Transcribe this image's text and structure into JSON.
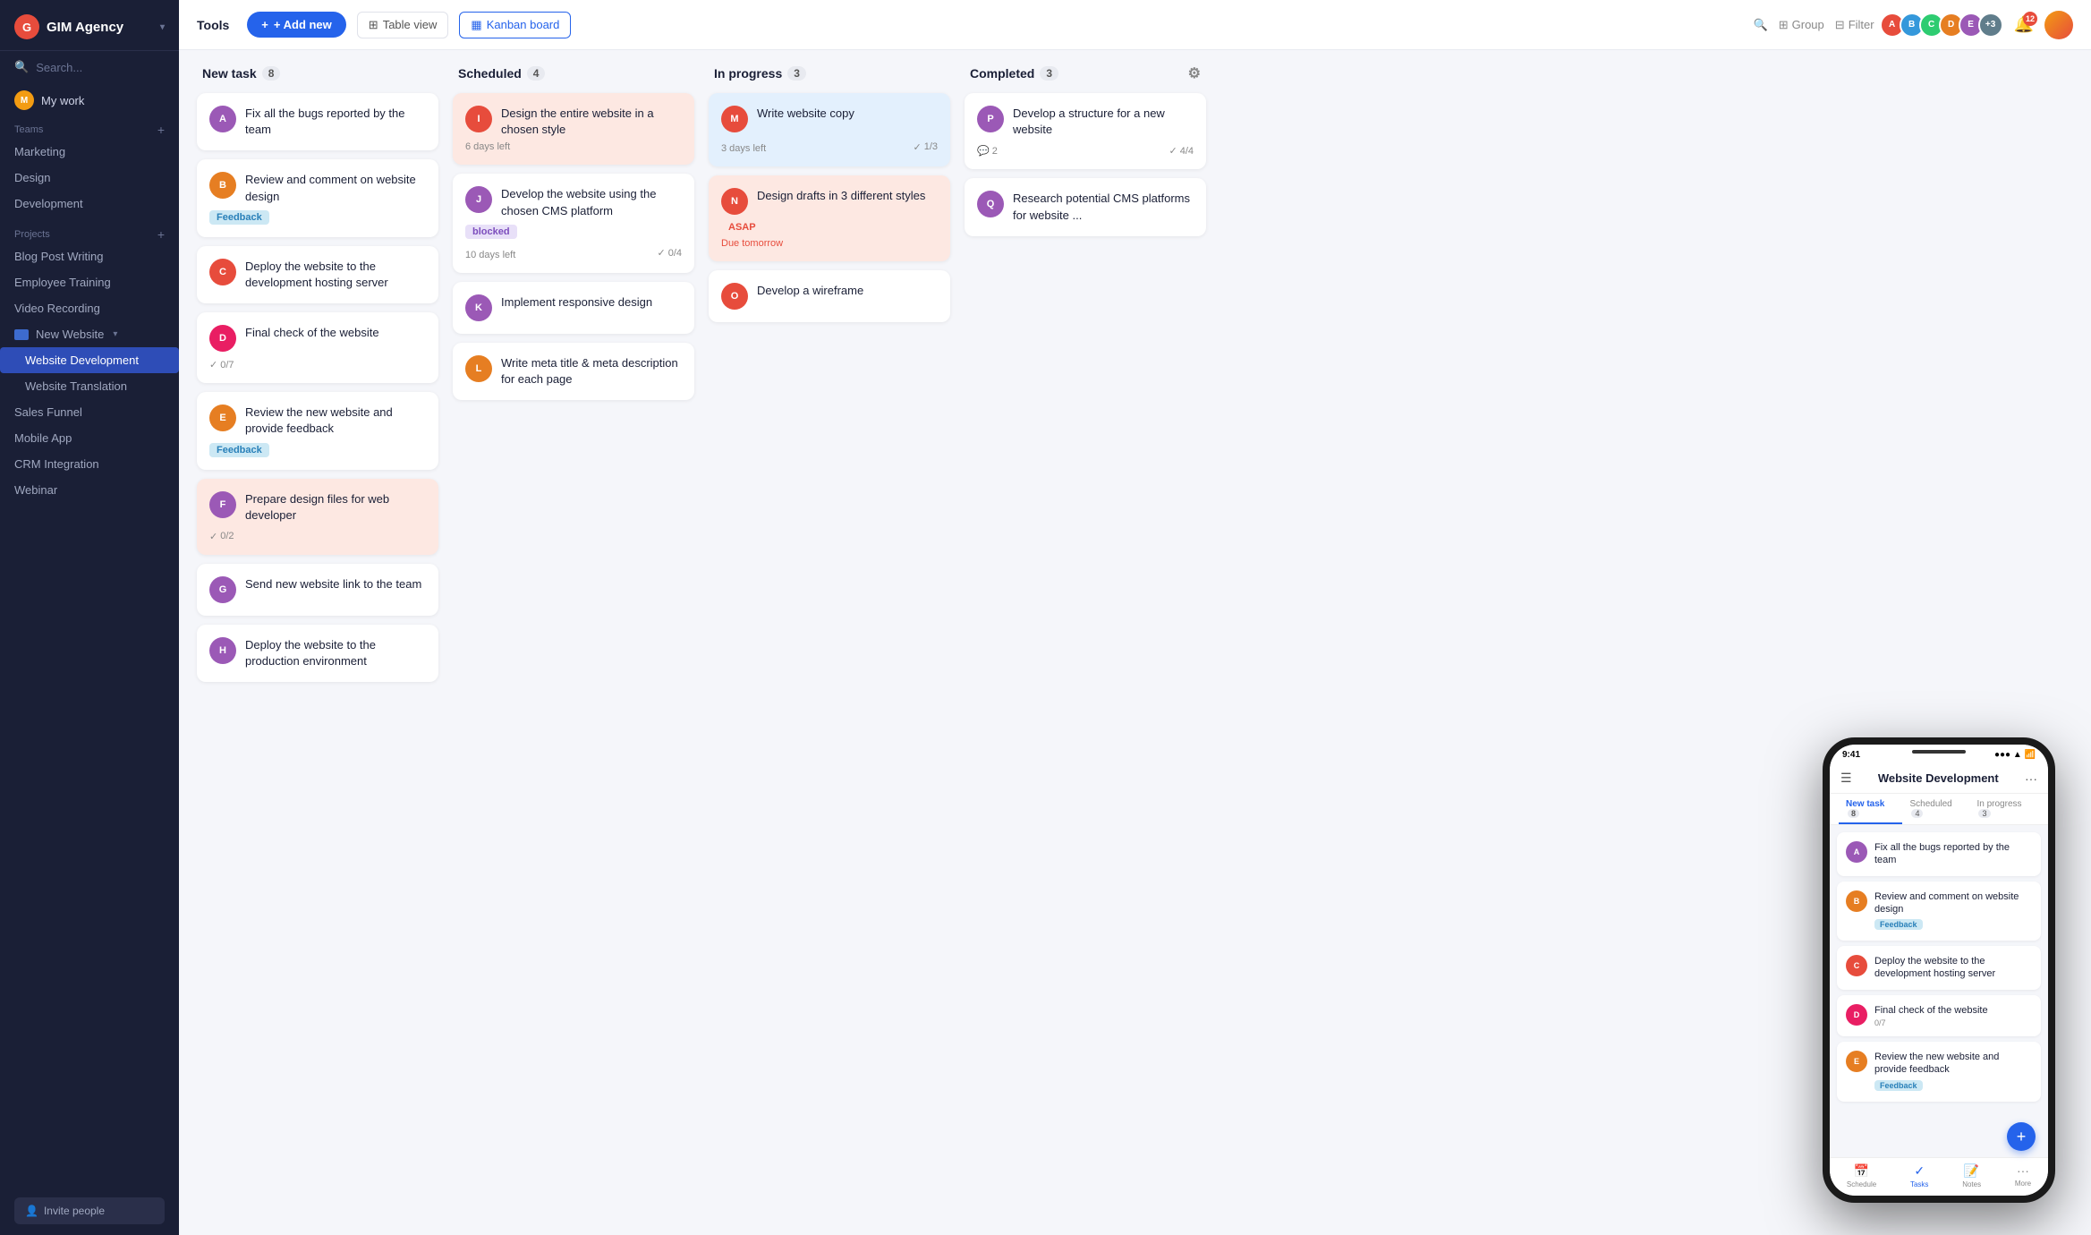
{
  "app": {
    "name": "GIM Agency",
    "logo_letter": "G"
  },
  "sidebar": {
    "search_placeholder": "Search...",
    "my_work": "My work",
    "teams_label": "Teams",
    "teams": [
      {
        "label": "Marketing"
      },
      {
        "label": "Design"
      },
      {
        "label": "Development"
      }
    ],
    "projects_label": "Projects",
    "projects": [
      {
        "label": "Blog Post Writing"
      },
      {
        "label": "Employee Training"
      },
      {
        "label": "Video Recording"
      },
      {
        "label": "New Website",
        "has_children": true
      },
      {
        "label": "Website Development",
        "active": true,
        "sub": true
      },
      {
        "label": "Website Translation",
        "sub": true
      },
      {
        "label": "Sales Funnel"
      },
      {
        "label": "Mobile App"
      },
      {
        "label": "CRM Integration"
      },
      {
        "label": "Webinar"
      }
    ],
    "invite_label": "Invite people"
  },
  "toolbar": {
    "tools_label": "Tools",
    "add_new": "+ Add new",
    "table_view": "Table view",
    "kanban_board": "Kanban board",
    "group_label": "Group",
    "filter_label": "Filter",
    "extra_avatars": "+3",
    "notif_count": "12"
  },
  "columns": [
    {
      "id": "new_task",
      "label": "New task",
      "count": 8
    },
    {
      "id": "scheduled",
      "label": "Scheduled",
      "count": 4
    },
    {
      "id": "in_progress",
      "label": "In progress",
      "count": 3
    },
    {
      "id": "completed",
      "label": "Completed",
      "count": 3
    }
  ],
  "new_task_cards": [
    {
      "id": "nt1",
      "title": "Fix all the bugs reported by the team",
      "avatar_color": "#9b59b6",
      "avatar_letter": "A"
    },
    {
      "id": "nt2",
      "title": "Review and comment on website design",
      "tag": "Feedback",
      "tag_type": "feedback",
      "avatar_color": "#e67e22",
      "avatar_letter": "B"
    },
    {
      "id": "nt3",
      "title": "Deploy the website to the development hosting server",
      "avatar_color": "#e74c3c",
      "avatar_letter": "C"
    },
    {
      "id": "nt4",
      "title": "Final check of the website",
      "check": "0/7",
      "avatar_color": "#e91e63",
      "avatar_letter": "D"
    },
    {
      "id": "nt5",
      "title": "Review the new website and provide feedback",
      "tag": "Feedback",
      "tag_type": "feedback",
      "avatar_color": "#e67e22",
      "avatar_letter": "E"
    },
    {
      "id": "nt6",
      "title": "Prepare design files for web developer",
      "check": "0/2",
      "salmon": true,
      "avatar_color": "#9b59b6",
      "avatar_letter": "F"
    },
    {
      "id": "nt7",
      "title": "Send new website link to the team",
      "avatar_color": "#9b59b6",
      "avatar_letter": "G"
    },
    {
      "id": "nt8",
      "title": "Deploy the website to the production environment",
      "avatar_color": "#9b59b6",
      "avatar_letter": "H"
    }
  ],
  "scheduled_cards": [
    {
      "id": "sc1",
      "title": "Design the entire website in a chosen style",
      "days_left": "6 days left",
      "salmon": true,
      "avatar_color": "#e74c3c",
      "avatar_letter": "I"
    },
    {
      "id": "sc2",
      "title": "Develop the website using the chosen CMS platform",
      "tag": "blocked",
      "tag_type": "blocked",
      "days_left": "10 days left",
      "check": "0/4",
      "avatar_color": "#9b59b6",
      "avatar_letter": "J"
    },
    {
      "id": "sc3",
      "title": "Implement responsive design",
      "avatar_color": "#9b59b6",
      "avatar_letter": "K"
    },
    {
      "id": "sc4",
      "title": "Write meta title & meta description for each page",
      "avatar_color": "#e67e22",
      "avatar_letter": "L"
    }
  ],
  "in_progress_cards": [
    {
      "id": "ip1",
      "title": "Write website copy",
      "days_left": "3 days left",
      "check": "1/3",
      "avatar_color": "#e74c3c",
      "avatar_letter": "M"
    },
    {
      "id": "ip2",
      "title": "Design drafts in 3 different styles",
      "tag": "ASAP",
      "tag_type": "asap",
      "due": "Due tomorrow",
      "salmon": true,
      "avatar_color": "#e74c3c",
      "avatar_letter": "N"
    },
    {
      "id": "ip3",
      "title": "Develop a wireframe",
      "avatar_color": "#e74c3c",
      "avatar_letter": "O"
    }
  ],
  "completed_cards": [
    {
      "id": "cp1",
      "title": "Develop a structure for a new website",
      "comment_count": 2,
      "check": "4/4",
      "avatar_color": "#9b59b6",
      "avatar_letter": "P"
    },
    {
      "id": "cp2",
      "title": "Research potential CMS platforms for website ...",
      "avatar_color": "#9b59b6",
      "avatar_letter": "Q"
    }
  ],
  "phone": {
    "time": "9:41",
    "title": "Website Development",
    "tabs": [
      "New task",
      "Scheduled",
      "In progress"
    ],
    "tab_counts": [
      8,
      4,
      3
    ],
    "active_tab": "New task",
    "cards": [
      {
        "title": "Fix all the bugs reported by the team",
        "avatar_color": "#9b59b6",
        "salmon": false
      },
      {
        "title": "Review and comment on website design",
        "tag": "Feedback",
        "avatar_color": "#e67e22",
        "salmon": false
      },
      {
        "title": "Deploy the website to the development hosting server",
        "avatar_color": "#e74c3c",
        "salmon": false
      },
      {
        "title": "Final check of the website",
        "check": "0/7",
        "avatar_color": "#e91e63",
        "salmon": false
      },
      {
        "title": "Review the new website and provide feedback",
        "tag": "Feedback",
        "avatar_color": "#e67e22",
        "salmon": false
      }
    ],
    "bottom_nav": [
      "Schedule",
      "Tasks",
      "Notes",
      "More"
    ]
  },
  "avatars": [
    {
      "color": "#e74c3c",
      "letter": "A"
    },
    {
      "color": "#3498db",
      "letter": "B"
    },
    {
      "color": "#2ecc71",
      "letter": "C"
    },
    {
      "color": "#e67e22",
      "letter": "D"
    },
    {
      "color": "#9b59b6",
      "letter": "E"
    }
  ]
}
